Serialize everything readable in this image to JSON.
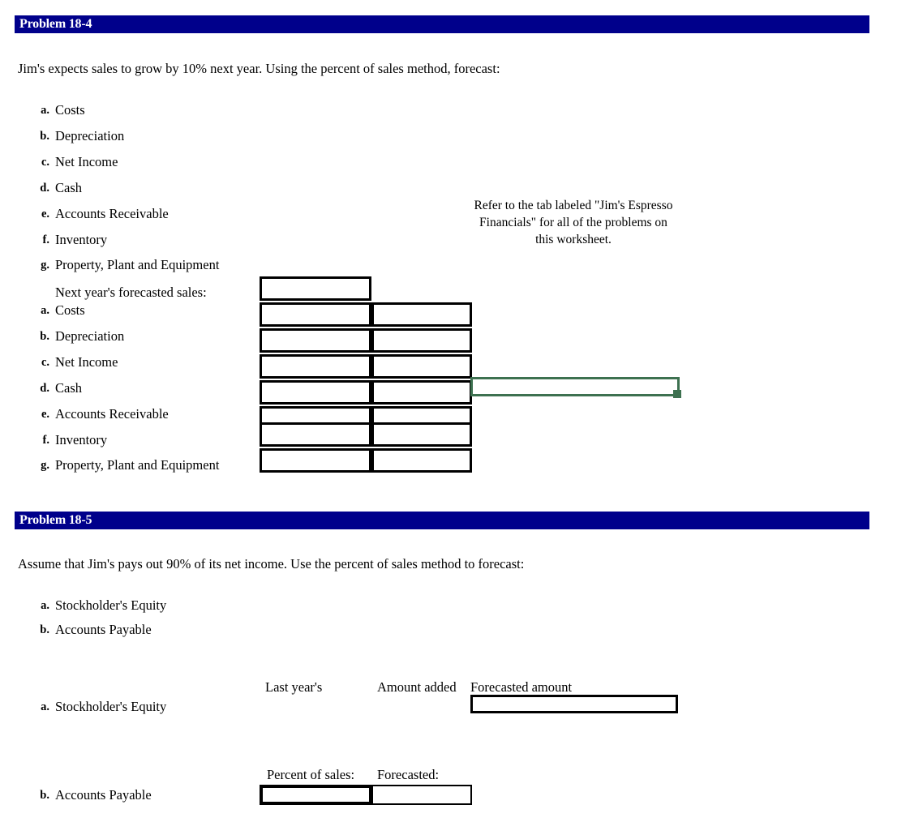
{
  "problem_18_4": {
    "banner_title": "Problem 18-4",
    "prompt": "Jim's expects sales to grow by 10% next year.  Using the percent of sales method, forecast:",
    "items": [
      {
        "marker": "a.",
        "label": "Costs"
      },
      {
        "marker": "b.",
        "label": "Depreciation"
      },
      {
        "marker": "c.",
        "label": "Net Income"
      },
      {
        "marker": "d.",
        "label": "Cash"
      },
      {
        "marker": "e.",
        "label": "Accounts Receivable"
      },
      {
        "marker": "f.",
        "label": "Inventory"
      },
      {
        "marker": "g.",
        "label": "Property, Plant and Equipment"
      }
    ],
    "side_note": "Refer to the tab labeled \"Jim's Espresso Financials\" for all of the problems on this worksheet.",
    "answer_section_label": "Next year's forecasted sales:",
    "answer_items": [
      {
        "marker": "a.",
        "label": "Costs"
      },
      {
        "marker": "b.",
        "label": "Depreciation"
      },
      {
        "marker": "c.",
        "label": "Net Income"
      },
      {
        "marker": "d.",
        "label": "Cash"
      },
      {
        "marker": "e.",
        "label": "Accounts Receivable"
      },
      {
        "marker": "f.",
        "label": "Inventory"
      },
      {
        "marker": "g.",
        "label": "Property, Plant and Equipment"
      }
    ],
    "grid": {
      "rows": [
        {
          "left_value": "",
          "right_value": "",
          "has_right_cell": false
        },
        {
          "left_value": "",
          "right_value": "",
          "has_right_cell": true
        },
        {
          "left_value": "",
          "right_value": "",
          "has_right_cell": true
        },
        {
          "left_value": "",
          "right_value": "",
          "has_right_cell": true
        },
        {
          "left_value": "",
          "right_value": "",
          "has_right_cell": true
        },
        {
          "left_value": "",
          "right_value": "",
          "has_right_cell": true
        },
        {
          "left_value": "",
          "right_value": "",
          "has_right_cell": true
        },
        {
          "left_value": "",
          "right_value": "",
          "has_right_cell": true
        }
      ]
    },
    "selection": {
      "value": "",
      "color": "#3D7150"
    }
  },
  "problem_18_5": {
    "banner_title": "Problem 18-5",
    "prompt": "Assume that Jim's pays out 90% of its net income.  Use the percent of sales method to forecast:",
    "items": [
      {
        "marker": "a.",
        "label": "Stockholder's Equity"
      },
      {
        "marker": "b.",
        "label": "Accounts Payable"
      }
    ],
    "answer_rows": [
      {
        "marker": "a.",
        "label": "Stockholder's Equity",
        "headers": [
          "Last year's",
          "Amount added",
          "Forecasted amount"
        ],
        "forecasted_amount_value": ""
      },
      {
        "marker": "b.",
        "label": "Accounts Payable",
        "headers": [
          "Percent of sales:",
          "Forecasted:"
        ],
        "percent_of_sales_value": "",
        "forecasted_value": ""
      }
    ]
  },
  "theme": {
    "banner_bg": "#00008B",
    "banner_fg": "#FFFFFF",
    "cell_border": "#000000",
    "selection_green": "#3D7150",
    "page_bg": "#FFFFFF"
  }
}
